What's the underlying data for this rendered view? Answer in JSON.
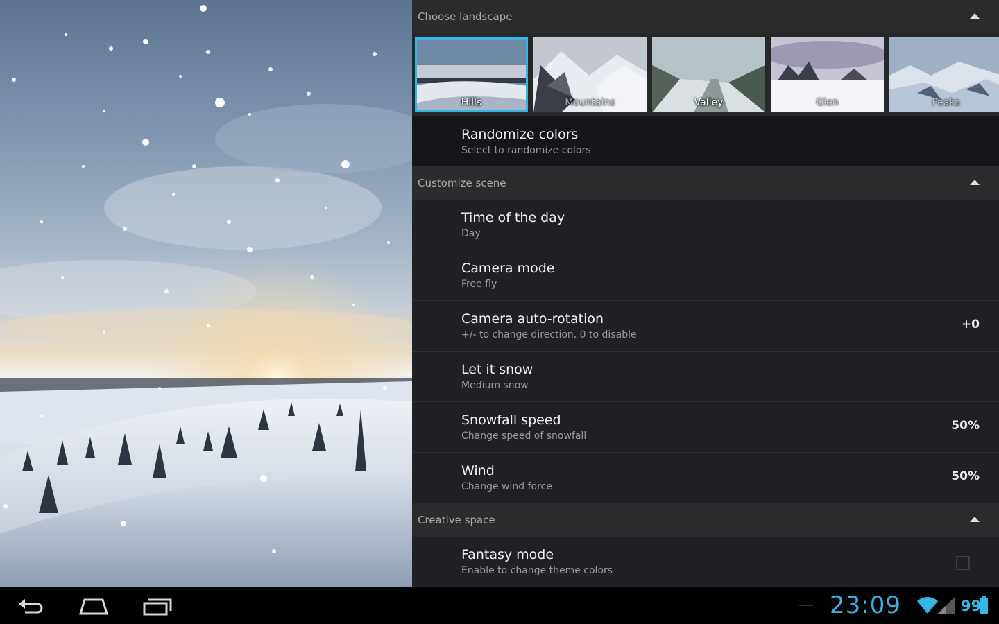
{
  "preview": {
    "scene": "snowy-hills-sunset"
  },
  "panel": {
    "sections": {
      "landscape": {
        "title": "Choose landscape"
      },
      "customize": {
        "title": "Customize scene"
      },
      "creative": {
        "title": "Creative space"
      }
    },
    "thumbnails": [
      {
        "label": "Hills",
        "selected": true
      },
      {
        "label": "Mountains",
        "selected": false
      },
      {
        "label": "Valley",
        "selected": false
      },
      {
        "label": "Glen",
        "selected": false
      },
      {
        "label": "Peaks",
        "selected": false
      }
    ],
    "randomize": {
      "title": "Randomize colors",
      "subtitle": "Select to randomize colors"
    },
    "settings": [
      {
        "title": "Time of the day",
        "subtitle": "Day",
        "value": ""
      },
      {
        "title": "Camera mode",
        "subtitle": "Free fly",
        "value": ""
      },
      {
        "title": "Camera auto-rotation",
        "subtitle": "+/- to change direction, 0 to disable",
        "value": "+0"
      },
      {
        "title": "Let it snow",
        "subtitle": "Medium snow",
        "value": ""
      },
      {
        "title": "Snowfall speed",
        "subtitle": "Change speed of snowfall",
        "value": "50%"
      },
      {
        "title": "Wind",
        "subtitle": "Change wind force",
        "value": "50%"
      }
    ],
    "fantasy": {
      "title": "Fantasy mode",
      "subtitle": "Enable to change theme colors",
      "checked": false
    }
  },
  "statusbar": {
    "time": "23:09",
    "battery": "99",
    "accent": "#33b5e5",
    "icons": [
      "back-icon",
      "home-icon",
      "recent-apps-icon",
      "wifi-icon",
      "signal-icon",
      "battery-icon"
    ]
  }
}
